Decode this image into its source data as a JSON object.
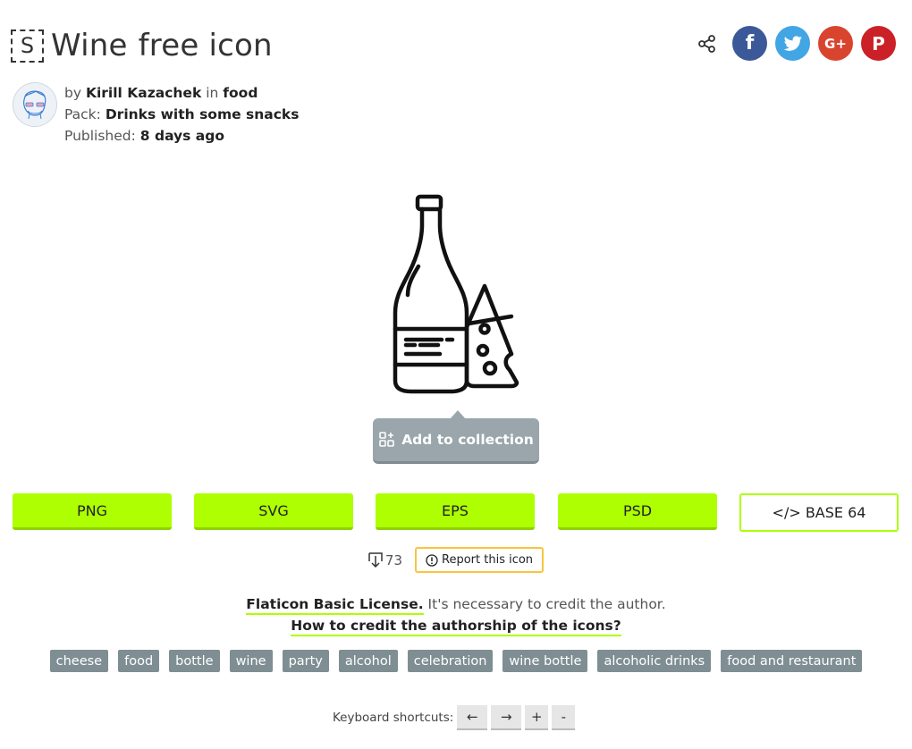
{
  "title": {
    "words": [
      "Wine",
      "free icon"
    ]
  },
  "author": {
    "by_prefix": "by",
    "name": "Kirill Kazachek",
    "in_prefix": "in",
    "category": "food",
    "pack_prefix": "Pack:",
    "pack": "Drinks with some snacks",
    "published_prefix": "Published:",
    "published": "8 days ago"
  },
  "collection_button": "Add to collection",
  "downloads": [
    {
      "label": "PNG"
    },
    {
      "label": "SVG"
    },
    {
      "label": "EPS"
    },
    {
      "label": "PSD"
    }
  ],
  "base64": "</> BASE 64",
  "download_count": "73",
  "report": "Report this icon",
  "license": {
    "link": "Flaticon Basic License.",
    "text": "It's necessary to credit the author.",
    "credit_link": "How to credit the authorship of the icons?"
  },
  "tags": [
    "cheese",
    "food",
    "bottle",
    "wine",
    "party",
    "alcohol",
    "celebration",
    "wine bottle",
    "alcoholic drinks",
    "food and restaurant"
  ],
  "shortcuts": {
    "label": "Keyboard shortcuts:",
    "keys": [
      "←",
      "→",
      "+",
      "-"
    ]
  },
  "social": {
    "facebook_glyph": "f",
    "googleplus_glyph": "G+",
    "pinterest_glyph": "P"
  },
  "colors": {
    "accent_green": "#adff02",
    "collection_gray": "#9aa6ab",
    "tag_gray": "#7f8e93",
    "report_yellow": "#f8c541",
    "facebook": "#3b5998",
    "twitter": "#42a5e4",
    "googleplus": "#d9442e",
    "pinterest": "#cb2027"
  },
  "icons": [
    "select-icon",
    "share-icon",
    "facebook-icon",
    "twitter-icon",
    "google-plus-icon",
    "pinterest-icon",
    "avatar",
    "wine-cheese-icon",
    "collection-icon",
    "download-icon",
    "alert-icon"
  ]
}
